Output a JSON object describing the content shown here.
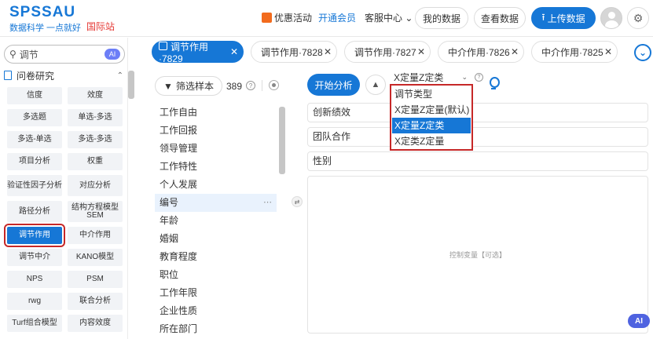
{
  "header": {
    "logo": "SPSSAU",
    "tagline": "数据科学 一点就好",
    "intl": "国际站",
    "promo": "优惠活动",
    "vip": "开通会员",
    "service": "客服中心",
    "my_data": "我的数据",
    "view_data": "查看数据",
    "upload": "上传数据"
  },
  "sidebar": {
    "search_value": "调节",
    "search_ai": "AI",
    "section": "问卷研究",
    "methods": [
      "信度",
      "效度",
      "多选题",
      "单选-多选",
      "多选-单选",
      "多选-多选",
      "项目分析",
      "权重",
      "验证性因子分析",
      "对应分析",
      "路径分析",
      "结构方程模型SEM",
      "调节作用",
      "中介作用",
      "调节中介",
      "KANO模型",
      "NPS",
      "PSM",
      "rwg",
      "联合分析",
      "Turf组合模型",
      "内容效度"
    ]
  },
  "tabs": [
    {
      "label": "调节作用·7829",
      "active": true
    },
    {
      "label": "调节作用·7828",
      "active": false
    },
    {
      "label": "调节作用·7827",
      "active": false
    },
    {
      "label": "中介作用·7826",
      "active": false
    },
    {
      "label": "中介作用·7825",
      "active": false
    }
  ],
  "filter": {
    "label": "筛选样本",
    "count": "389"
  },
  "variables": [
    "工作自由",
    "工作回报",
    "领导管理",
    "工作特性",
    "个人发展",
    "编号",
    "年龄",
    "婚姻",
    "教育程度",
    "职位",
    "工作年限",
    "企业性质",
    "所在部门"
  ],
  "selected_variable": "编号",
  "analysis": {
    "start": "开始分析",
    "mode_value": "X定量Z定类",
    "dropdown_options": [
      "调节类型",
      "X定量Z定量(默认)",
      "X定量Z定类",
      "X定类Z定量"
    ],
    "dropdown_selected": "X定量Z定类",
    "box_y": "创新绩效",
    "box_x": "团队合作",
    "box_z": "性别",
    "box_control": "控制变量【可选】",
    "ai_badge": "AI"
  },
  "colors": {
    "brand": "#1677d6",
    "highlight": "#c62828",
    "intl": "#e53935"
  }
}
